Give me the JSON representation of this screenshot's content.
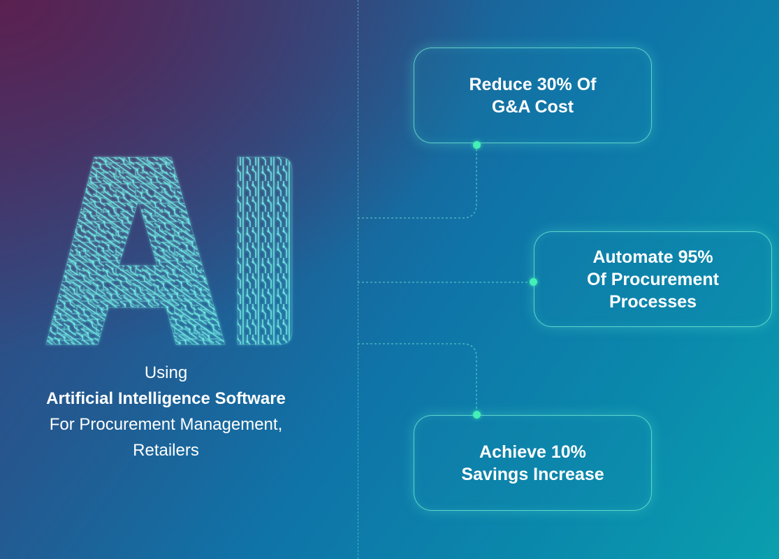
{
  "caption": {
    "line1": "Using",
    "line2": "Artificial Intelligence Software",
    "line3": "For Procurement Management,",
    "line4": "Retailers"
  },
  "graphic_label": "AI",
  "benefits": [
    {
      "line1": "Reduce 30% Of",
      "line2": "G&A Cost"
    },
    {
      "line1": "Automate 95%",
      "line2": "Of Procurement",
      "line3": "Processes"
    },
    {
      "line1": "Achieve 10%",
      "line2": "Savings Increase"
    }
  ],
  "colors": {
    "accent": "#43f0b5",
    "circuit": "#6fe6e0",
    "bg_start": "#5a2150",
    "bg_end": "#0a9fae"
  }
}
